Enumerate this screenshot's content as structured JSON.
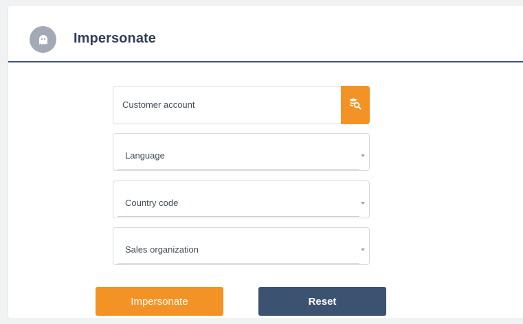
{
  "header": {
    "title": "Impersonate",
    "icon": "ghost-icon"
  },
  "form": {
    "customer_account": {
      "placeholder": "Customer account",
      "value": "",
      "search_icon": "database-search-icon"
    },
    "language": {
      "placeholder": "Language",
      "value": ""
    },
    "country_code": {
      "placeholder": "Country code",
      "value": ""
    },
    "sales_organization": {
      "placeholder": "Sales organization",
      "value": ""
    }
  },
  "actions": {
    "impersonate_label": "Impersonate",
    "reset_label": "Reset"
  },
  "colors": {
    "accent": "#f39325",
    "primary": "#3c5271",
    "avatar": "#a3aab5"
  }
}
